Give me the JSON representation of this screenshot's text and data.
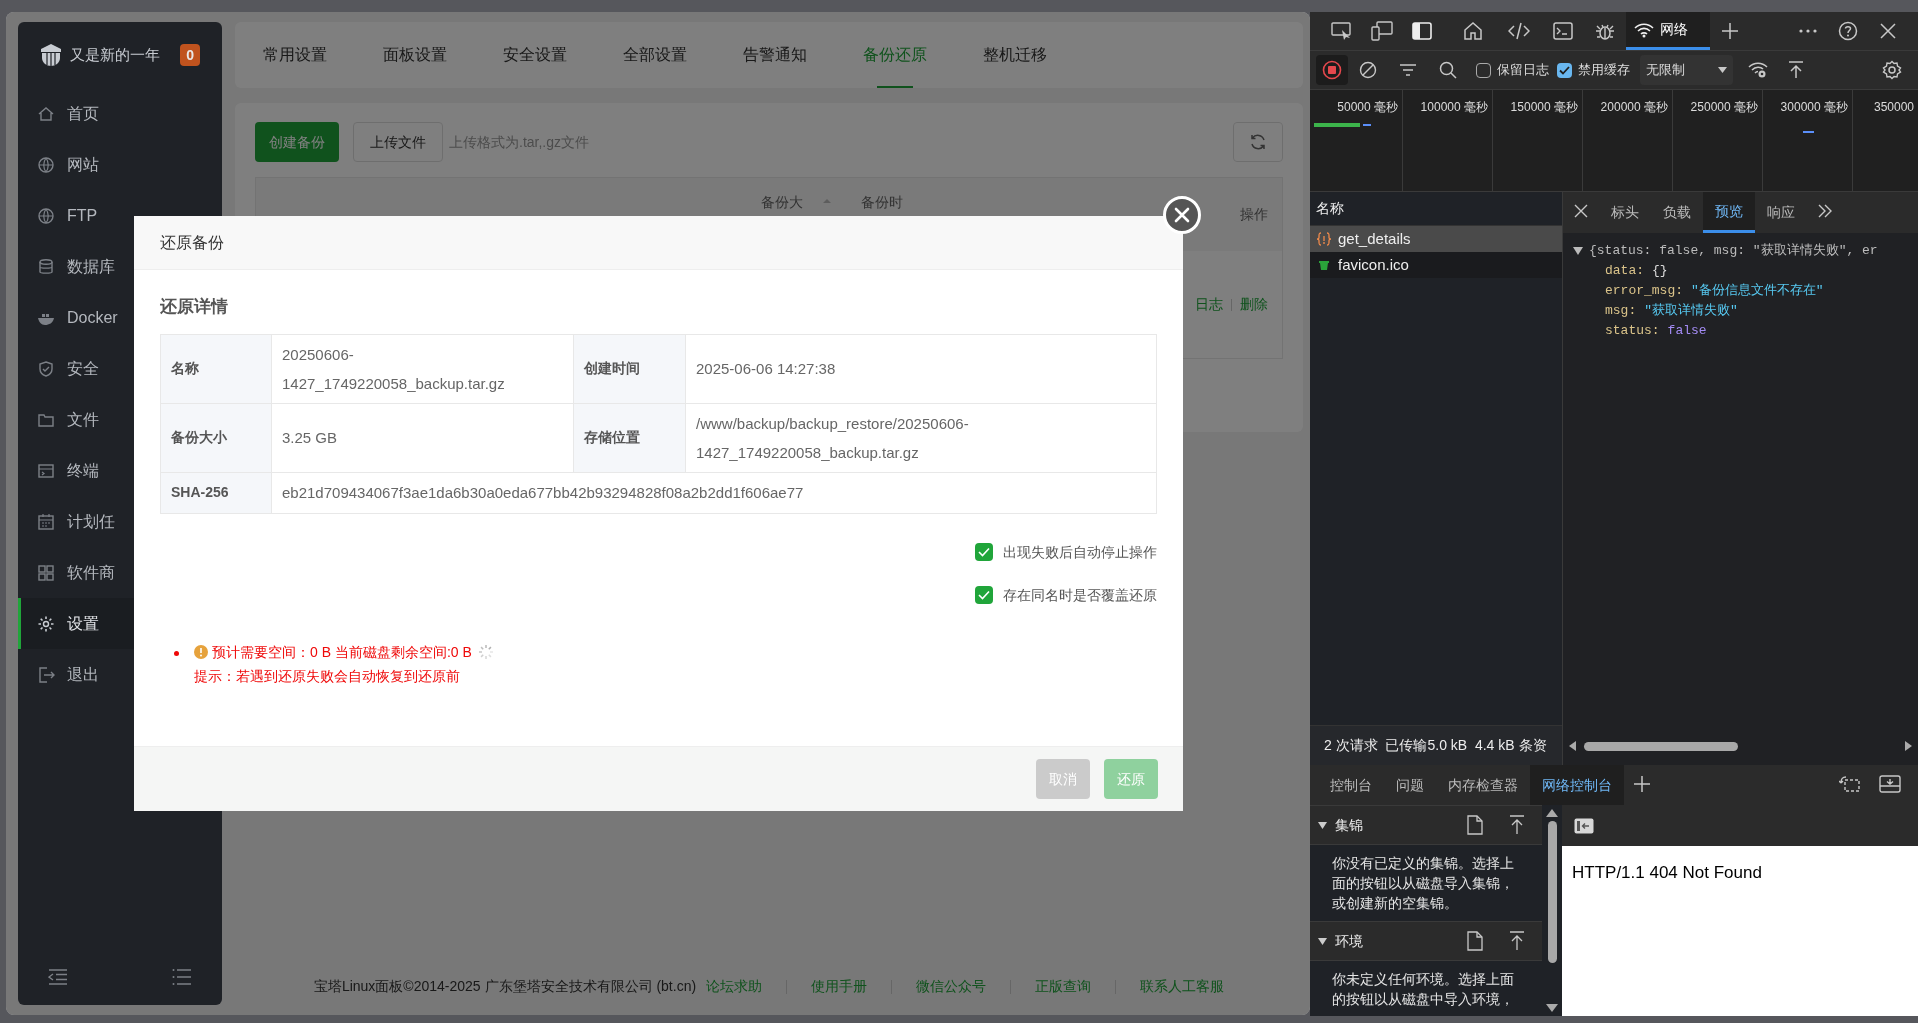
{
  "sidebar": {
    "title": "又是新的一年",
    "badge": "0",
    "items": [
      {
        "label": "首页",
        "selected": false
      },
      {
        "label": "网站",
        "selected": false
      },
      {
        "label": "FTP",
        "selected": false
      },
      {
        "label": "数据库",
        "selected": false
      },
      {
        "label": "Docker",
        "selected": false
      },
      {
        "label": "安全",
        "selected": false
      },
      {
        "label": "文件",
        "selected": false
      },
      {
        "label": "终端",
        "selected": false
      },
      {
        "label": "计划任",
        "selected": false
      },
      {
        "label": "软件商",
        "selected": false
      },
      {
        "label": "设置",
        "selected": true
      },
      {
        "label": "退出",
        "selected": false
      }
    ]
  },
  "settings_tabs": [
    {
      "label": "常用设置",
      "selected": false
    },
    {
      "label": "面板设置",
      "selected": false
    },
    {
      "label": "安全设置",
      "selected": false
    },
    {
      "label": "全部设置",
      "selected": false
    },
    {
      "label": "告警通知",
      "selected": false
    },
    {
      "label": "备份还原",
      "selected": true
    },
    {
      "label": "整机迁移",
      "selected": false
    }
  ],
  "backup_toolbar": {
    "create_button": "创建备份",
    "upload_button": "上传文件",
    "hint": "上传格式为.tar,.gz文件"
  },
  "backup_table": {
    "columns": [
      "备份大",
      "备份时",
      "操作"
    ],
    "row_actions": [
      "日志",
      "删除"
    ]
  },
  "footer": {
    "copyright": "宝塔Linux面板©2014-2025 广东堡塔安全技术有限公司 (bt.cn)",
    "links": [
      "论坛求助",
      "使用手册",
      "微信公众号",
      "正版查询",
      "联系人工客服"
    ]
  },
  "dialog": {
    "title": "还原备份",
    "section_title": "还原详情",
    "rows": [
      {
        "cells": [
          {
            "label": "名称",
            "value": "20250606-1427_1749220058_backup.tar.gz"
          },
          {
            "label": "创建时间",
            "value": "2025-06-06 14:27:38"
          }
        ]
      },
      {
        "cells": [
          {
            "label": "备份大小",
            "value": "3.25 GB"
          },
          {
            "label": "存储位置",
            "value": "/www/backup/backup_restore/20250606-1427_1749220058_backup.tar.gz"
          }
        ]
      },
      {
        "cells": [
          {
            "label": "SHA-256",
            "value": "eb21d709434067f3ae1da6b30a0eda677bb42b93294828f08a2b2dd1f606ae77"
          }
        ]
      }
    ],
    "options": [
      {
        "label": "出现失败后自动停止操作",
        "checked": true
      },
      {
        "label": "存在同名时是否覆盖还原",
        "checked": true
      }
    ],
    "warning": "预计需要空间：0 B 当前磁盘剩余空间:0 B",
    "tip": "提示：若遇到还原失败会自动恢复到还原前",
    "buttons": [
      {
        "label": "取消",
        "kind": "cancel",
        "disabled": true
      },
      {
        "label": "还原",
        "kind": "confirm",
        "disabled": true
      }
    ]
  },
  "devtools": {
    "panel_tab": "网络",
    "network_toolbar": {
      "options": [
        {
          "label": "保留日志",
          "checked": false
        },
        {
          "label": "禁用缓存",
          "checked": true
        }
      ],
      "throttling": "无限制"
    },
    "timeline_ticks": [
      "50000 毫秒",
      "100000 毫秒",
      "150000 毫秒",
      "200000 毫秒",
      "250000 毫秒",
      "300000 毫秒",
      "350000"
    ],
    "requests": {
      "header": "名称",
      "items": [
        {
          "name": "get_details",
          "kind": "xhr",
          "selected": true
        },
        {
          "name": "favicon.ico",
          "kind": "image",
          "selected": false
        }
      ]
    },
    "detail_tabs": [
      {
        "label": "标头",
        "selected": false
      },
      {
        "label": "负载",
        "selected": false
      },
      {
        "label": "预览",
        "selected": true
      },
      {
        "label": "响应",
        "selected": false
      }
    ],
    "preview": {
      "summary": "{status: false, msg: \"获取详情失败\", er",
      "fields": [
        {
          "key": "data:",
          "value": "{}",
          "kind": "object"
        },
        {
          "key": "error_msg:",
          "value": "\"备份信息文件不存在\"",
          "kind": "string"
        },
        {
          "key": "msg:",
          "value": "\"获取详情失败\"",
          "kind": "string"
        },
        {
          "key": "status:",
          "value": "false",
          "kind": "boolean"
        }
      ]
    },
    "status_bar": "2 次请求  已传输5.0 kB  4.4 kB 条资",
    "drawer_tabs": [
      {
        "label": "控制台",
        "selected": false
      },
      {
        "label": "问题",
        "selected": false
      },
      {
        "label": "内存检查器",
        "selected": false
      },
      {
        "label": "网络控制台",
        "selected": true
      }
    ],
    "sections": [
      {
        "title": "集锦",
        "text": "你没有已定义的集锦。选择上面的按钮以从磁盘导入集锦，或创建新的空集锦。"
      },
      {
        "title": "环境",
        "text": "你未定义任何环境。选择上面的按钮以从磁盘中导入环境，"
      }
    ],
    "response_preview": "HTTP/1.1 404 Not Found"
  }
}
